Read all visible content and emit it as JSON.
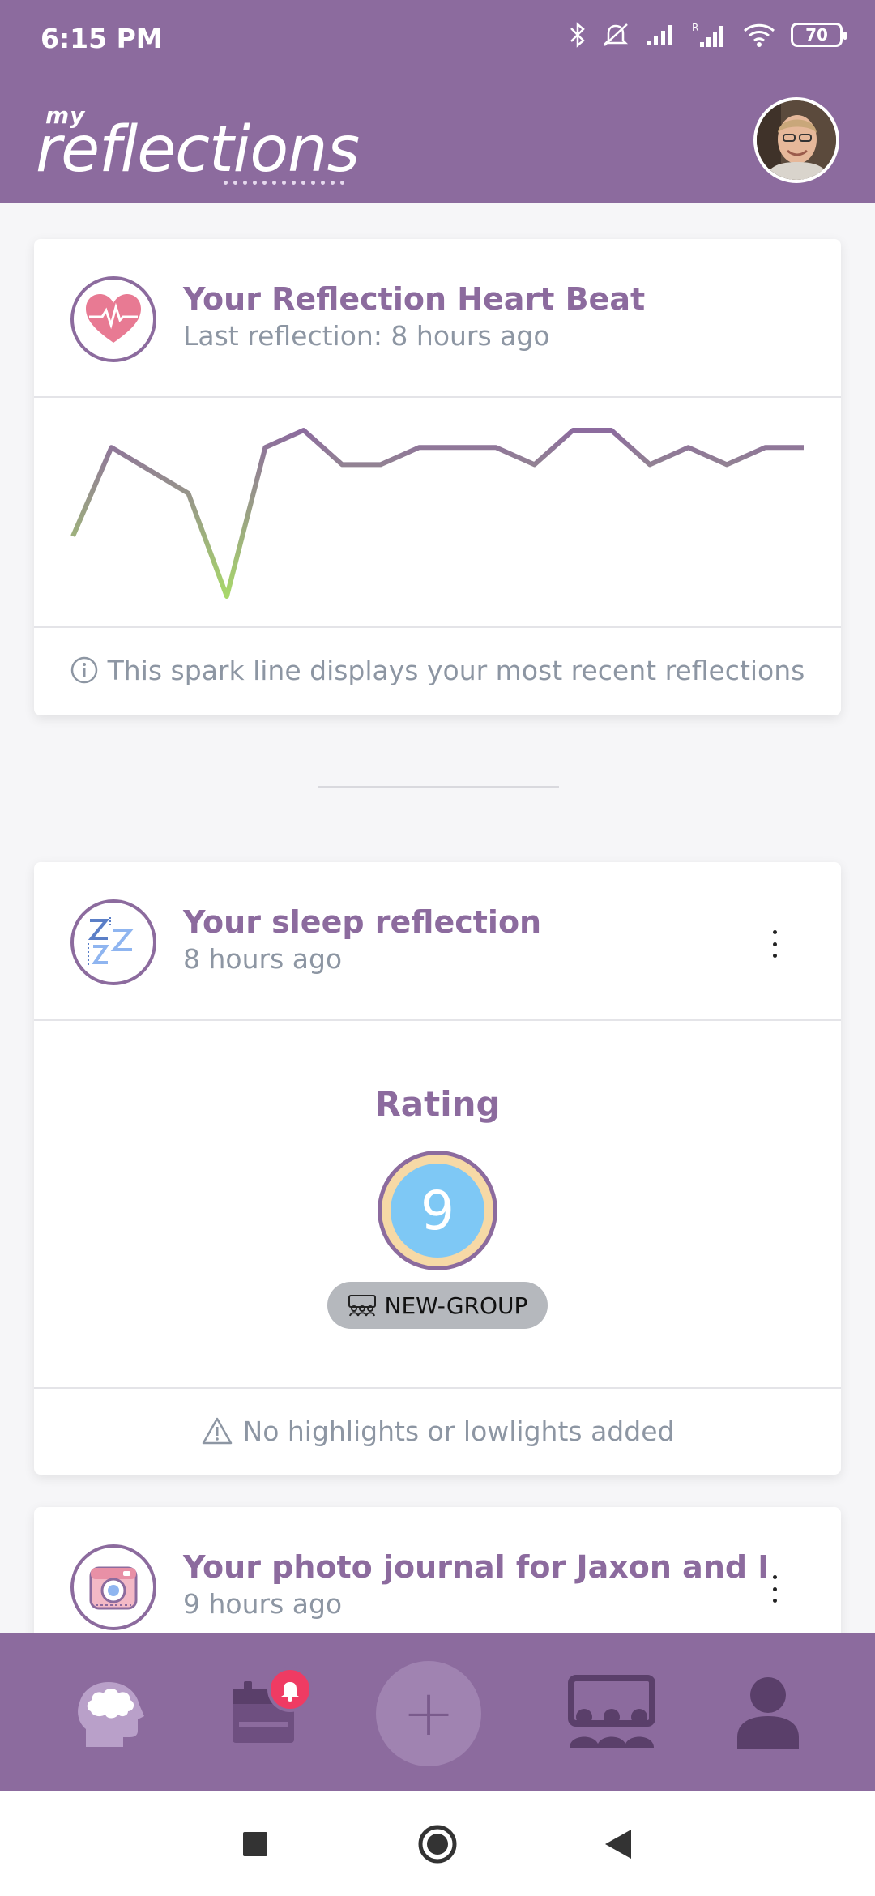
{
  "status_bar": {
    "time": "6:15 PM",
    "battery": "70",
    "icons": [
      "bluetooth-icon",
      "mute-icon",
      "signal-icon",
      "signal-roaming-icon",
      "wifi-icon",
      "battery-icon"
    ]
  },
  "header": {
    "logo_small": "my",
    "logo_main": "reflections",
    "avatar": "user-avatar"
  },
  "heartbeat_card": {
    "title": "Your Reflection Heart Beat",
    "subtitle": "Last reflection: 8 hours ago",
    "footer": "This spark line displays your most recent reflections",
    "sparkline": [
      3.1,
      6.2,
      5.4,
      4.6,
      1.0,
      6.2,
      6.8,
      5.6,
      5.6,
      6.2,
      6.2,
      6.2,
      5.6,
      6.8,
      6.8,
      5.6,
      6.2,
      5.6,
      6.2,
      6.2
    ]
  },
  "sleep_card": {
    "title": "Your sleep reflection",
    "subtitle": "8 hours ago",
    "rating_label": "Rating",
    "rating_value": "9",
    "group_chip": "NEW-GROUP",
    "footer": "No highlights or lowlights added"
  },
  "photo_card": {
    "title": "Your photo journal for Jaxon and I",
    "subtitle": "9 hours ago"
  },
  "bottom_nav": {
    "items": [
      "brain-icon",
      "calendar-icon",
      "add-button",
      "group-icon",
      "profile-icon"
    ],
    "fab_label": "+"
  },
  "colors": {
    "primary": "#8c6b9e",
    "muted_text": "#8d96a3",
    "badge": "#ef3b63",
    "spark_low": "#a8d86a",
    "spark_high": "#8c6b9e"
  }
}
